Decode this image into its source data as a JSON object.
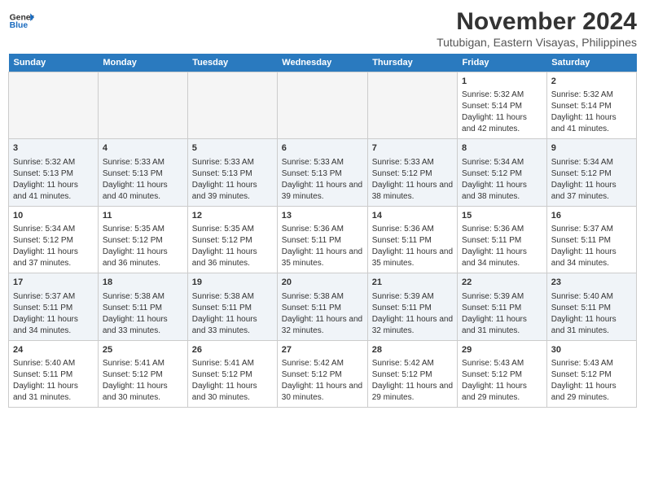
{
  "logo": {
    "line1": "General",
    "line2": "Blue"
  },
  "title": "November 2024",
  "subtitle": "Tutubigan, Eastern Visayas, Philippines",
  "headers": [
    "Sunday",
    "Monday",
    "Tuesday",
    "Wednesday",
    "Thursday",
    "Friday",
    "Saturday"
  ],
  "weeks": [
    [
      {
        "day": "",
        "sunrise": "",
        "sunset": "",
        "daylight": "",
        "empty": true
      },
      {
        "day": "",
        "sunrise": "",
        "sunset": "",
        "daylight": "",
        "empty": true
      },
      {
        "day": "",
        "sunrise": "",
        "sunset": "",
        "daylight": "",
        "empty": true
      },
      {
        "day": "",
        "sunrise": "",
        "sunset": "",
        "daylight": "",
        "empty": true
      },
      {
        "day": "",
        "sunrise": "",
        "sunset": "",
        "daylight": "",
        "empty": true
      },
      {
        "day": "1",
        "sunrise": "Sunrise: 5:32 AM",
        "sunset": "Sunset: 5:14 PM",
        "daylight": "Daylight: 11 hours and 42 minutes.",
        "empty": false
      },
      {
        "day": "2",
        "sunrise": "Sunrise: 5:32 AM",
        "sunset": "Sunset: 5:14 PM",
        "daylight": "Daylight: 11 hours and 41 minutes.",
        "empty": false
      }
    ],
    [
      {
        "day": "3",
        "sunrise": "Sunrise: 5:32 AM",
        "sunset": "Sunset: 5:13 PM",
        "daylight": "Daylight: 11 hours and 41 minutes.",
        "empty": false
      },
      {
        "day": "4",
        "sunrise": "Sunrise: 5:33 AM",
        "sunset": "Sunset: 5:13 PM",
        "daylight": "Daylight: 11 hours and 40 minutes.",
        "empty": false
      },
      {
        "day": "5",
        "sunrise": "Sunrise: 5:33 AM",
        "sunset": "Sunset: 5:13 PM",
        "daylight": "Daylight: 11 hours and 39 minutes.",
        "empty": false
      },
      {
        "day": "6",
        "sunrise": "Sunrise: 5:33 AM",
        "sunset": "Sunset: 5:13 PM",
        "daylight": "Daylight: 11 hours and 39 minutes.",
        "empty": false
      },
      {
        "day": "7",
        "sunrise": "Sunrise: 5:33 AM",
        "sunset": "Sunset: 5:12 PM",
        "daylight": "Daylight: 11 hours and 38 minutes.",
        "empty": false
      },
      {
        "day": "8",
        "sunrise": "Sunrise: 5:34 AM",
        "sunset": "Sunset: 5:12 PM",
        "daylight": "Daylight: 11 hours and 38 minutes.",
        "empty": false
      },
      {
        "day": "9",
        "sunrise": "Sunrise: 5:34 AM",
        "sunset": "Sunset: 5:12 PM",
        "daylight": "Daylight: 11 hours and 37 minutes.",
        "empty": false
      }
    ],
    [
      {
        "day": "10",
        "sunrise": "Sunrise: 5:34 AM",
        "sunset": "Sunset: 5:12 PM",
        "daylight": "Daylight: 11 hours and 37 minutes.",
        "empty": false
      },
      {
        "day": "11",
        "sunrise": "Sunrise: 5:35 AM",
        "sunset": "Sunset: 5:12 PM",
        "daylight": "Daylight: 11 hours and 36 minutes.",
        "empty": false
      },
      {
        "day": "12",
        "sunrise": "Sunrise: 5:35 AM",
        "sunset": "Sunset: 5:12 PM",
        "daylight": "Daylight: 11 hours and 36 minutes.",
        "empty": false
      },
      {
        "day": "13",
        "sunrise": "Sunrise: 5:36 AM",
        "sunset": "Sunset: 5:11 PM",
        "daylight": "Daylight: 11 hours and 35 minutes.",
        "empty": false
      },
      {
        "day": "14",
        "sunrise": "Sunrise: 5:36 AM",
        "sunset": "Sunset: 5:11 PM",
        "daylight": "Daylight: 11 hours and 35 minutes.",
        "empty": false
      },
      {
        "day": "15",
        "sunrise": "Sunrise: 5:36 AM",
        "sunset": "Sunset: 5:11 PM",
        "daylight": "Daylight: 11 hours and 34 minutes.",
        "empty": false
      },
      {
        "day": "16",
        "sunrise": "Sunrise: 5:37 AM",
        "sunset": "Sunset: 5:11 PM",
        "daylight": "Daylight: 11 hours and 34 minutes.",
        "empty": false
      }
    ],
    [
      {
        "day": "17",
        "sunrise": "Sunrise: 5:37 AM",
        "sunset": "Sunset: 5:11 PM",
        "daylight": "Daylight: 11 hours and 34 minutes.",
        "empty": false
      },
      {
        "day": "18",
        "sunrise": "Sunrise: 5:38 AM",
        "sunset": "Sunset: 5:11 PM",
        "daylight": "Daylight: 11 hours and 33 minutes.",
        "empty": false
      },
      {
        "day": "19",
        "sunrise": "Sunrise: 5:38 AM",
        "sunset": "Sunset: 5:11 PM",
        "daylight": "Daylight: 11 hours and 33 minutes.",
        "empty": false
      },
      {
        "day": "20",
        "sunrise": "Sunrise: 5:38 AM",
        "sunset": "Sunset: 5:11 PM",
        "daylight": "Daylight: 11 hours and 32 minutes.",
        "empty": false
      },
      {
        "day": "21",
        "sunrise": "Sunrise: 5:39 AM",
        "sunset": "Sunset: 5:11 PM",
        "daylight": "Daylight: 11 hours and 32 minutes.",
        "empty": false
      },
      {
        "day": "22",
        "sunrise": "Sunrise: 5:39 AM",
        "sunset": "Sunset: 5:11 PM",
        "daylight": "Daylight: 11 hours and 31 minutes.",
        "empty": false
      },
      {
        "day": "23",
        "sunrise": "Sunrise: 5:40 AM",
        "sunset": "Sunset: 5:11 PM",
        "daylight": "Daylight: 11 hours and 31 minutes.",
        "empty": false
      }
    ],
    [
      {
        "day": "24",
        "sunrise": "Sunrise: 5:40 AM",
        "sunset": "Sunset: 5:11 PM",
        "daylight": "Daylight: 11 hours and 31 minutes.",
        "empty": false
      },
      {
        "day": "25",
        "sunrise": "Sunrise: 5:41 AM",
        "sunset": "Sunset: 5:12 PM",
        "daylight": "Daylight: 11 hours and 30 minutes.",
        "empty": false
      },
      {
        "day": "26",
        "sunrise": "Sunrise: 5:41 AM",
        "sunset": "Sunset: 5:12 PM",
        "daylight": "Daylight: 11 hours and 30 minutes.",
        "empty": false
      },
      {
        "day": "27",
        "sunrise": "Sunrise: 5:42 AM",
        "sunset": "Sunset: 5:12 PM",
        "daylight": "Daylight: 11 hours and 30 minutes.",
        "empty": false
      },
      {
        "day": "28",
        "sunrise": "Sunrise: 5:42 AM",
        "sunset": "Sunset: 5:12 PM",
        "daylight": "Daylight: 11 hours and 29 minutes.",
        "empty": false
      },
      {
        "day": "29",
        "sunrise": "Sunrise: 5:43 AM",
        "sunset": "Sunset: 5:12 PM",
        "daylight": "Daylight: 11 hours and 29 minutes.",
        "empty": false
      },
      {
        "day": "30",
        "sunrise": "Sunrise: 5:43 AM",
        "sunset": "Sunset: 5:12 PM",
        "daylight": "Daylight: 11 hours and 29 minutes.",
        "empty": false
      }
    ]
  ]
}
